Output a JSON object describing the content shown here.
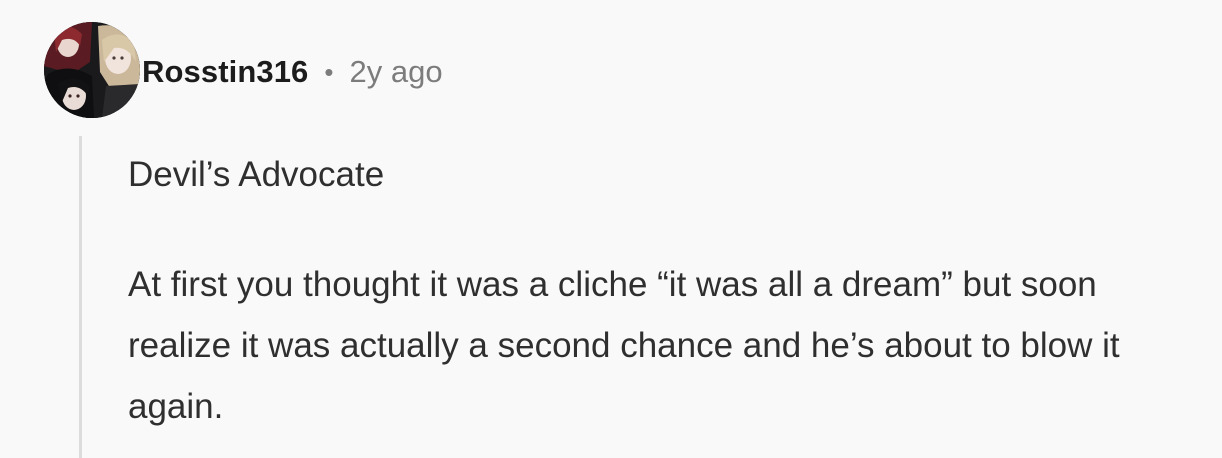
{
  "comment": {
    "username": "Rosstin316",
    "separator": "•",
    "age": "2y ago",
    "paragraphs": [
      "Devil’s Advocate",
      "At first you thought it was a cliche “it was all a dream” but soon realize it was actually a second chance and he’s about to blow it again."
    ]
  },
  "colors": {
    "background": "#f9f9f9",
    "username": "#1c1c1c",
    "meta": "#7c7c7c",
    "body_text": "#2f2f2f",
    "thread_line": "#dcdcdc"
  },
  "icons": {
    "avatar": "user-avatar-image"
  }
}
